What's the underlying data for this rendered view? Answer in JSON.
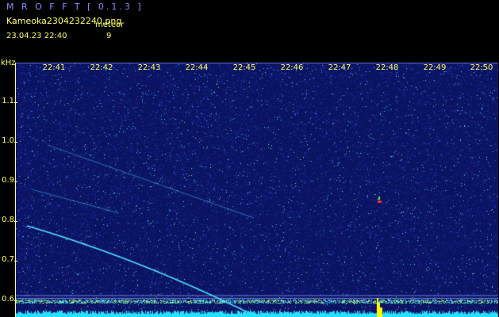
{
  "header": {
    "app_title": "M R O F F T  [ 0.1.3 ]",
    "file_name": "Kameoka2304232240.png",
    "meteor_label": "meteor",
    "timestamp": "23.04.23  22:40",
    "meteor_count": "9"
  },
  "axes": {
    "y_unit": "kHz",
    "y_ticks": [
      {
        "label": "1.1",
        "value": 1.1
      },
      {
        "label": "1.0",
        "value": 1.0
      },
      {
        "label": "0.9",
        "value": 0.9
      },
      {
        "label": "0.8",
        "value": 0.8
      },
      {
        "label": "0.7",
        "value": 0.7
      },
      {
        "label": "0.6",
        "value": 0.6
      }
    ],
    "x_ticks": [
      "22:41",
      "22:42",
      "22:43",
      "22:44",
      "22:45",
      "22:46",
      "22:47",
      "22:48",
      "22:49",
      "22:50"
    ],
    "y_range_khz": [
      0.57,
      1.2
    ],
    "x_range_minutes": [
      22.4,
      22.6
    ]
  },
  "colors": {
    "background": "#000000",
    "plot_background": "#0b1462",
    "label": "#ffff66",
    "title": "#8c8cff",
    "noise_dim": "#2a3cc8",
    "noise_bright": "#3cc8ff",
    "meteor_trail": "#4fe0ff",
    "baseline": "#27e0ff",
    "spike": "#ffff00"
  }
}
